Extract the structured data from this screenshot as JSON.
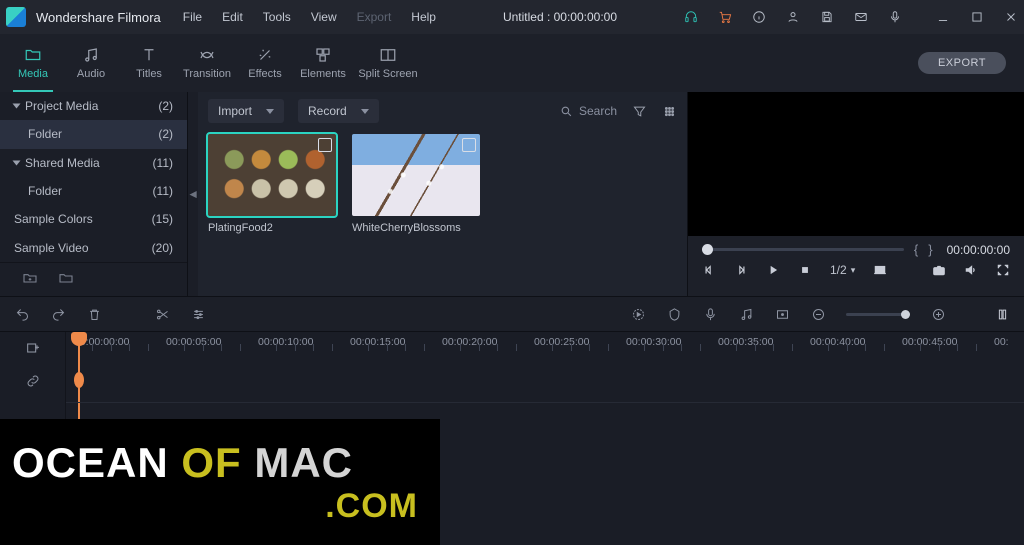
{
  "titlebar": {
    "brand": "Wondershare Filmora",
    "menu": [
      "File",
      "Edit",
      "Tools",
      "View",
      "Export",
      "Help"
    ],
    "menu_disabled_index": 4,
    "doc_title": "Untitled : 00:00:00:00"
  },
  "tabs": [
    {
      "label": "Media",
      "active": true
    },
    {
      "label": "Audio"
    },
    {
      "label": "Titles"
    },
    {
      "label": "Transition"
    },
    {
      "label": "Effects"
    },
    {
      "label": "Elements"
    },
    {
      "label": "Split Screen"
    }
  ],
  "export_button": "EXPORT",
  "sidebar": {
    "items": [
      {
        "label": "Project Media",
        "count": "(2)",
        "expandable": true
      },
      {
        "label": "Folder",
        "count": "(2)",
        "child": true,
        "selected": true
      },
      {
        "label": "Shared Media",
        "count": "(11)",
        "expandable": true
      },
      {
        "label": "Folder",
        "count": "(11)",
        "child": true
      },
      {
        "label": "Sample Colors",
        "count": "(15)"
      },
      {
        "label": "Sample Video",
        "count": "(20)"
      }
    ]
  },
  "mediapanel": {
    "import": "Import",
    "record": "Record",
    "search_placeholder": "Search",
    "thumbs": [
      {
        "name": "PlatingFood2",
        "selected": true,
        "style": "food"
      },
      {
        "name": "WhiteCherryBlossoms",
        "selected": false,
        "style": "blossom"
      }
    ]
  },
  "preview": {
    "mark_in": "{",
    "mark_out": "}",
    "timecode": "00:00:00:00",
    "zoom": "1/2"
  },
  "timeline": {
    "ticks": [
      "00:00:00:00",
      "00:00:05:00",
      "00:00:10:00",
      "00:00:15:00",
      "00:00:20:00",
      "00:00:25:00",
      "00:00:30:00",
      "00:00:35:00",
      "00:00:40:00",
      "00:00:45:00",
      "00:"
    ]
  },
  "watermark": {
    "w1": "OCEAN ",
    "w2": "OF ",
    "w3": "MAC",
    "r2": ".COM"
  }
}
